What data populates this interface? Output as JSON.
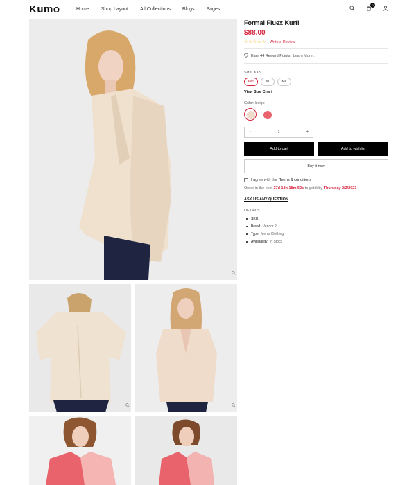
{
  "header": {
    "logo": "Kumo",
    "nav": [
      "Home",
      "Shop Layout",
      "All Collections",
      "Blogs",
      "Pages"
    ],
    "cart_count": "0",
    "icons": [
      "search-icon",
      "cart-icon",
      "user-icon"
    ]
  },
  "product": {
    "title": "Formal Fluex Kurti",
    "price": "$88.00",
    "stars": "☆☆☆☆☆",
    "review_link": "Write a Review",
    "reward_text": "Earn 44 Reward Points",
    "learn_more": "Learn More...",
    "size_label": "Size: XXS",
    "sizes": [
      "XXS",
      "M",
      "ML"
    ],
    "size_chart": "View Size Chart",
    "color_label": "Color: beige",
    "quantity": "1",
    "add_to_cart": "Add to cart",
    "add_to_wishlist": "Add to wishlist",
    "buy_now": "Buy it now",
    "terms_prefix": "I agree with the",
    "terms_link": "Terms & conditions",
    "order_prefix": "Order in the next",
    "order_time": "27d 18h 18m 50s",
    "order_mid": "to get it by",
    "order_date": "Thursday 2/2/2023",
    "ask": "ASK US ANY QUESTION",
    "details_heading": "DETAILS",
    "details": [
      {
        "k": "SKU:",
        "v": ""
      },
      {
        "k": "Brand:",
        "v": "Vendor 2"
      },
      {
        "k": "Type:",
        "v": "Men's Clothing"
      },
      {
        "k": "Availability:",
        "v": "In Stock"
      }
    ]
  },
  "colors": {
    "accent": "#d6243d",
    "beige": "#ecdcc9",
    "pink": "#e8636b"
  }
}
